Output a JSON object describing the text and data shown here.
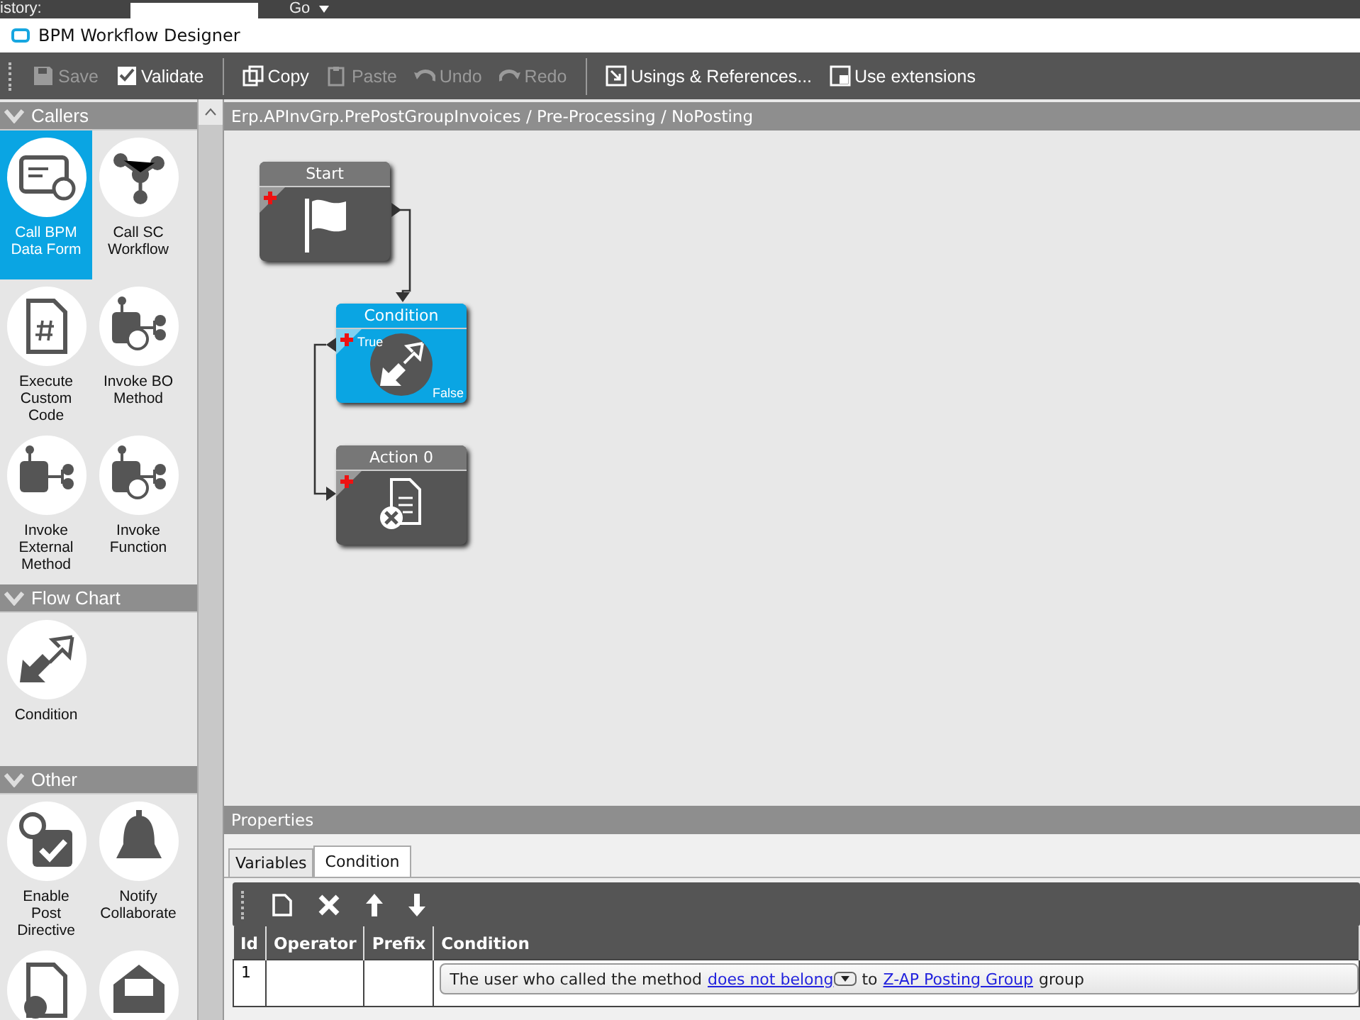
{
  "top_bar": {
    "history_label": "istory:",
    "go_label": "Go"
  },
  "window": {
    "title": "BPM Workflow Designer"
  },
  "toolbar": [
    {
      "label": "Save",
      "disabled": true
    },
    {
      "label": "Validate",
      "disabled": false
    },
    {
      "label": "Copy",
      "disabled": false
    },
    {
      "label": "Paste",
      "disabled": true
    },
    {
      "label": "Undo",
      "disabled": true
    },
    {
      "label": "Redo",
      "disabled": true
    },
    {
      "label": "Usings & References...",
      "disabled": false
    },
    {
      "label": "Use extensions",
      "disabled": false
    }
  ],
  "palette": {
    "sections": [
      {
        "title": "Callers",
        "expanded": true,
        "items": [
          {
            "label": "Call BPM Data Form",
            "selected": true
          },
          {
            "label": "Call SC Workflow",
            "selected": false
          },
          {
            "label": "Execute Custom Code",
            "selected": false
          },
          {
            "label": "Invoke BO Method",
            "selected": false
          },
          {
            "label": "Invoke External Method",
            "selected": false
          },
          {
            "label": "Invoke Function",
            "selected": false
          }
        ]
      },
      {
        "title": "Flow Chart",
        "expanded": true,
        "items": [
          {
            "label": "Condition",
            "selected": false
          }
        ]
      },
      {
        "title": "Other",
        "expanded": true,
        "items": [
          {
            "label": "Enable Post Directive",
            "selected": false
          },
          {
            "label": "Notify Collaborate",
            "selected": false
          },
          {
            "selected": false
          },
          {
            "selected": false
          }
        ]
      }
    ]
  },
  "breadcrumb": "Erp.APInvGrp.PrePostGroupInvoices / Pre-Processing / NoPosting",
  "nodes": [
    {
      "title": "Start",
      "kind": "start",
      "selected": false
    },
    {
      "title": "Condition",
      "kind": "condition",
      "selected": true,
      "true_label": "True",
      "false_label": "False"
    },
    {
      "title": "Action 0",
      "kind": "action",
      "selected": false
    }
  ],
  "properties": {
    "title": "Properties",
    "tabs": [
      {
        "label": "Variables",
        "selected": false
      },
      {
        "label": "Condition",
        "selected": true
      }
    ],
    "columns": [
      "Id",
      "Operator",
      "Prefix",
      "Condition"
    ],
    "rows": [
      {
        "id": "1",
        "condition": [
          {
            "kind": "text",
            "text": "The user who called the method"
          },
          {
            "kind": "dropdown-link",
            "text": "does not belong"
          },
          {
            "kind": "text",
            "text": "to"
          },
          {
            "kind": "link",
            "text": "Z-AP Posting Group"
          },
          {
            "kind": "text",
            "text": "group"
          }
        ]
      }
    ]
  }
}
